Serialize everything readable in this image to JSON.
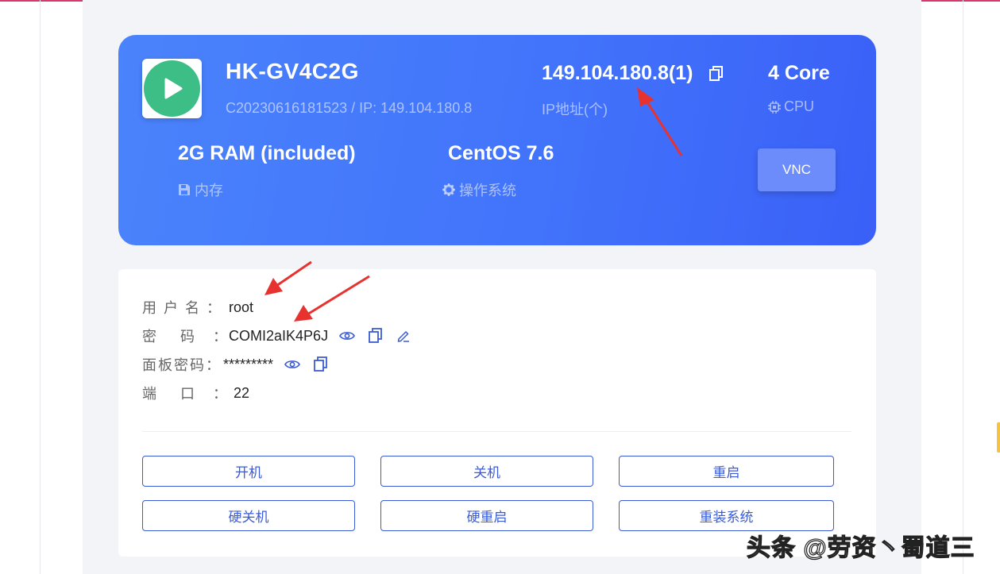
{
  "server": {
    "name": "HK-GV4C2G",
    "sub": "C20230616181523 / IP: 149.104.180.8",
    "ip": "149.104.180.8(1)",
    "ip_label": "IP地址(个)",
    "cpu": "4 Core",
    "cpu_label": "CPU",
    "ram": "2G RAM (included)",
    "ram_label": "内存",
    "os": "CentOS 7.6",
    "os_label": "操作系统",
    "vnc_label": "VNC",
    "status_color": "#3cbe86"
  },
  "credentials": {
    "username_label": "用 户 名 ：",
    "username": "root",
    "password_label": "密    码   ：",
    "password": "COMI2aIK4P6J",
    "panel_password_label": "面板密码：",
    "panel_password": "*********",
    "port_label": "端    口   ：",
    "port": "22"
  },
  "actions": {
    "power_on": "开机",
    "shutdown": "关机",
    "restart": "重启",
    "hard_shutdown": "硬关机",
    "hard_restart": "硬重启",
    "reinstall": "重装系统"
  },
  "watermark": "头条 @劳资丶蜀道三",
  "colors": {
    "card_blue": "#4274fb",
    "button_border": "#3b5bd6",
    "annotation_red": "#e8322f"
  }
}
